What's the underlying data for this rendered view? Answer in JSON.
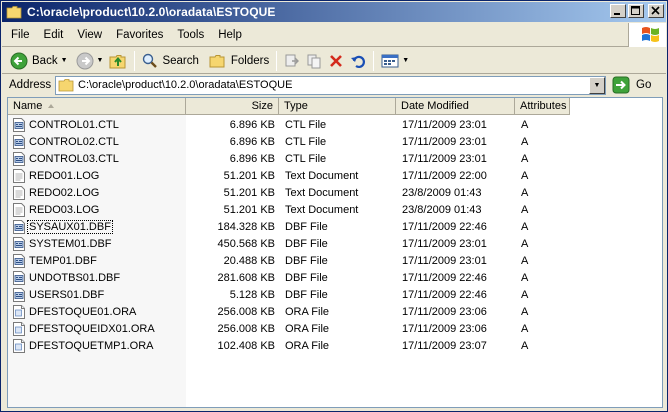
{
  "window": {
    "title": "C:\\oracle\\product\\10.2.0\\oradata\\ESTOQUE"
  },
  "menubar": {
    "items": [
      "File",
      "Edit",
      "View",
      "Favorites",
      "Tools",
      "Help"
    ]
  },
  "toolbar": {
    "back_label": "Back",
    "search_label": "Search",
    "folders_label": "Folders"
  },
  "address": {
    "label": "Address",
    "path": "C:\\oracle\\product\\10.2.0\\oradata\\ESTOQUE",
    "go_label": "Go"
  },
  "columns": [
    {
      "label": "Name"
    },
    {
      "label": "Size"
    },
    {
      "label": "Type"
    },
    {
      "label": "Date Modified"
    },
    {
      "label": "Attributes"
    }
  ],
  "files": [
    {
      "name": "CONTROL01.CTL",
      "size": "6.896 KB",
      "type": "CTL File",
      "date": "17/11/2009 23:01",
      "attr": "A",
      "icon": "system-file-icon"
    },
    {
      "name": "CONTROL02.CTL",
      "size": "6.896 KB",
      "type": "CTL File",
      "date": "17/11/2009 23:01",
      "attr": "A",
      "icon": "system-file-icon"
    },
    {
      "name": "CONTROL03.CTL",
      "size": "6.896 KB",
      "type": "CTL File",
      "date": "17/11/2009 23:01",
      "attr": "A",
      "icon": "system-file-icon"
    },
    {
      "name": "REDO01.LOG",
      "size": "51.201 KB",
      "type": "Text Document",
      "date": "17/11/2009 22:00",
      "attr": "A",
      "icon": "text-document-icon"
    },
    {
      "name": "REDO02.LOG",
      "size": "51.201 KB",
      "type": "Text Document",
      "date": "23/8/2009 01:43",
      "attr": "A",
      "icon": "text-document-icon"
    },
    {
      "name": "REDO03.LOG",
      "size": "51.201 KB",
      "type": "Text Document",
      "date": "23/8/2009 01:43",
      "attr": "A",
      "icon": "text-document-icon"
    },
    {
      "name": "SYSAUX01.DBF",
      "size": "184.328 KB",
      "type": "DBF File",
      "date": "17/11/2009 22:46",
      "attr": "A",
      "icon": "system-file-icon",
      "focused": true
    },
    {
      "name": "SYSTEM01.DBF",
      "size": "450.568 KB",
      "type": "DBF File",
      "date": "17/11/2009 23:01",
      "attr": "A",
      "icon": "system-file-icon"
    },
    {
      "name": "TEMP01.DBF",
      "size": "20.488 KB",
      "type": "DBF File",
      "date": "17/11/2009 23:01",
      "attr": "A",
      "icon": "system-file-icon"
    },
    {
      "name": "UNDOTBS01.DBF",
      "size": "281.608 KB",
      "type": "DBF File",
      "date": "17/11/2009 22:46",
      "attr": "A",
      "icon": "system-file-icon"
    },
    {
      "name": "USERS01.DBF",
      "size": "5.128 KB",
      "type": "DBF File",
      "date": "17/11/2009 22:46",
      "attr": "A",
      "icon": "system-file-icon"
    },
    {
      "name": "DFESTOQUE01.ORA",
      "size": "256.008 KB",
      "type": "ORA File",
      "date": "17/11/2009 23:06",
      "attr": "A",
      "icon": "generic-file-icon"
    },
    {
      "name": "DFESTOQUEIDX01.ORA",
      "size": "256.008 KB",
      "type": "ORA File",
      "date": "17/11/2009 23:06",
      "attr": "A",
      "icon": "generic-file-icon"
    },
    {
      "name": "DFESTOQUETMP1.ORA",
      "size": "102.408 KB",
      "type": "ORA File",
      "date": "17/11/2009 23:07",
      "attr": "A",
      "icon": "generic-file-icon"
    }
  ]
}
